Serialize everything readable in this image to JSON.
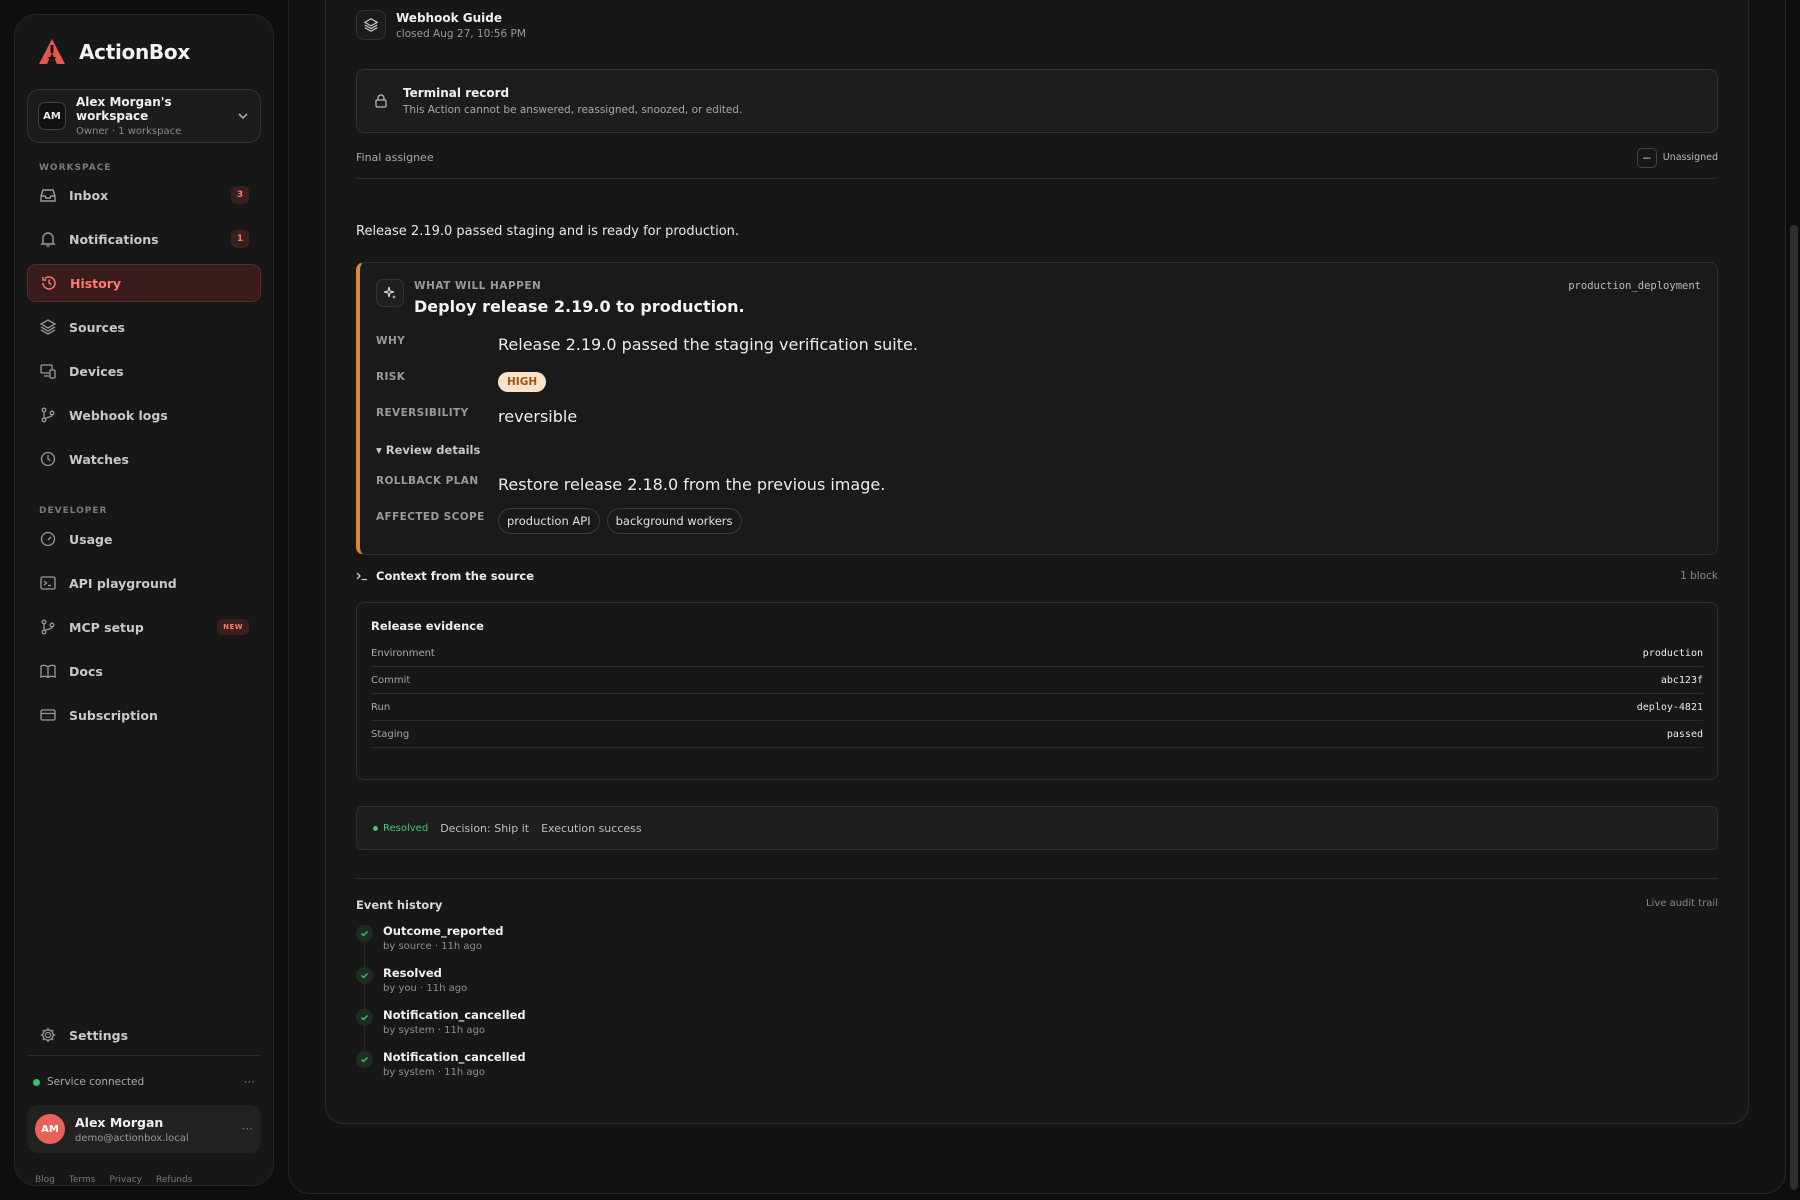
{
  "sidebar": {
    "brand": "ActionBox",
    "workspace": {
      "avatar": "AM",
      "name": "Alex Morgan's workspace",
      "sub": "Owner · 1 workspace"
    },
    "section_workspace": "WORKSPACE",
    "section_developer": "DEVELOPER",
    "items": [
      {
        "label": "Inbox",
        "badge": "3"
      },
      {
        "label": "Notifications",
        "badge": "1"
      },
      {
        "label": "History"
      },
      {
        "label": "Sources"
      },
      {
        "label": "Devices"
      },
      {
        "label": "Webhook logs"
      },
      {
        "label": "Watches"
      },
      {
        "label": "Usage"
      },
      {
        "label": "API playground"
      },
      {
        "label": "MCP setup",
        "badge": "NEW"
      },
      {
        "label": "Docs"
      },
      {
        "label": "Subscription"
      },
      {
        "label": "Settings"
      }
    ],
    "service": "Service connected",
    "more": "···",
    "user": {
      "avatar": "AM",
      "name": "Alex Morgan",
      "email": "demo@actionbox.local"
    },
    "footer": [
      "Blog",
      "Terms",
      "Privacy",
      "Refunds"
    ]
  },
  "detail": {
    "source_name": "Webhook Guide",
    "closed": "closed Aug 27, 10:56 PM",
    "terminal_title": "Terminal record",
    "terminal_sub": "This Action cannot be answered, reassigned, snoozed, or edited.",
    "final_assignee_label": "Final assignee",
    "final_assignee_minus": "−",
    "final_assignee_value": "Unassigned",
    "summary": "Release 2.19.0 passed staging and is ready for production.",
    "what": {
      "kicker": "WHAT WILL HAPPEN",
      "title": "Deploy release 2.19.0 to production.",
      "code": "production_deployment",
      "why_label": "WHY",
      "why": "Release 2.19.0 passed the staging verification suite.",
      "risk_label": "RISK",
      "risk": "HIGH",
      "rev_label": "REVERSIBILITY",
      "rev": "reversible",
      "review_toggle": "▾ Review details",
      "rollback_label": "ROLLBACK PLAN",
      "rollback": "Restore release 2.18.0 from the previous image.",
      "scope_label": "AFFECTED SCOPE",
      "scope": [
        "production API",
        "background workers"
      ]
    },
    "context_title": "Context from the source",
    "context_count": "1 block",
    "evidence": {
      "title": "Release evidence",
      "rows": [
        {
          "k": "Environment",
          "v": "production"
        },
        {
          "k": "Commit",
          "v": "abc123f"
        },
        {
          "k": "Run",
          "v": "deploy-4821"
        },
        {
          "k": "Staging",
          "v": "passed"
        }
      ]
    },
    "status": {
      "resolved": "Resolved",
      "decision": "Decision: Ship it",
      "execution": "Execution success"
    },
    "event_history_title": "Event history",
    "event_history_right": "Live audit trail",
    "events": [
      {
        "name": "Outcome_reported",
        "by": "by source · 11h ago"
      },
      {
        "name": "Resolved",
        "by": "by you · 11h ago"
      },
      {
        "name": "Notification_cancelled",
        "by": "by system · 11h ago"
      },
      {
        "name": "Notification_cancelled",
        "by": "by system · 11h ago"
      }
    ]
  },
  "colors": {
    "accent": "#ff7a6e",
    "risk_bg": "#f7e4c8",
    "success": "#46c279",
    "what_border": "#d8893a"
  }
}
